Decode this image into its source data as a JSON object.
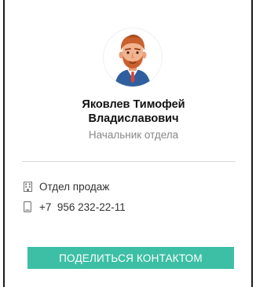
{
  "contact": {
    "name_line1": "Яковлев Тимофей",
    "name_line2": "Владиславович",
    "position": "Начальник отдела",
    "avatar_icon": "person-avatar-icon"
  },
  "details": {
    "department": "Отдел продаж",
    "department_icon": "building-icon",
    "phone": "+7  956 232-22-11",
    "phone_icon": "mobile-phone-icon"
  },
  "actions": {
    "share_label": "ПОДЕЛИТЬСЯ КОНТАКТОМ"
  },
  "colors": {
    "accent": "#3dbfa5",
    "muted_text": "#888888",
    "divider": "#d9d9d9"
  }
}
